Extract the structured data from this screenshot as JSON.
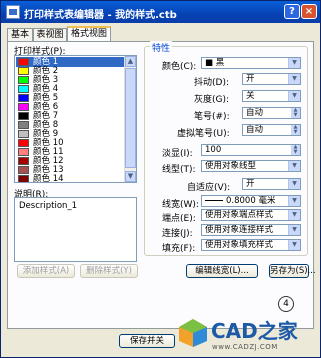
{
  "window": {
    "title": "打印样式表编辑器 - 我的样式.ctb"
  },
  "tabs": [
    {
      "label": "基本"
    },
    {
      "label": "表视图"
    },
    {
      "label": "格式视图"
    }
  ],
  "left": {
    "styles_label": "打印样式(P):",
    "styles": [
      {
        "name": "颜色 1",
        "color": "#ff0000",
        "selected": true
      },
      {
        "name": "颜色 2",
        "color": "#ffff00"
      },
      {
        "name": "颜色 3",
        "color": "#00ff00"
      },
      {
        "name": "颜色 4",
        "color": "#00ffff"
      },
      {
        "name": "颜色 5",
        "color": "#0000ff"
      },
      {
        "name": "颜色 6",
        "color": "#ff00ff"
      },
      {
        "name": "颜色 7",
        "color": "#000000"
      },
      {
        "name": "颜色 8",
        "color": "#808080"
      },
      {
        "name": "颜色 9",
        "color": "#c0c0c0"
      },
      {
        "name": "颜色 10",
        "color": "#ff0000"
      },
      {
        "name": "颜色 11",
        "color": "#ff7f7f"
      },
      {
        "name": "颜色 12",
        "color": "#a50000"
      },
      {
        "name": "颜色 13",
        "color": "#a55252"
      },
      {
        "name": "颜色 14",
        "color": "#7f0000"
      }
    ],
    "description_label": "说明(R):",
    "description_value": "Description_1",
    "add_style_label": "添加样式(A)",
    "delete_style_label": "删除样式(Y)"
  },
  "props": {
    "group_title": "特性",
    "color_label": "颜色(C):",
    "color_value": "■ 黑",
    "dither_label": "抖动(D):",
    "dither_value": "开",
    "grayscale_label": "灰度(G):",
    "grayscale_value": "关",
    "pen_label": "笔号(#):",
    "pen_value": "自动",
    "vpen_label": "虚拟笔号(U):",
    "vpen_value": "自动",
    "screening_label": "淡显(I):",
    "screening_value": "100",
    "linetype_label": "线型(T):",
    "linetype_value": "使用对象线型",
    "adaptive_label": "自适应(V):",
    "adaptive_value": "开",
    "lineweight_label": "线宽(W):",
    "lineweight_value": "0.8000 毫米",
    "endstyle_label": "端点(E):",
    "endstyle_value": "使用对象端点样式",
    "joinstyle_label": "连接(J):",
    "joinstyle_value": "使用对象连接样式",
    "fillstyle_label": "填充(F):",
    "fillstyle_value": "使用对象填充样式",
    "edit_lineweights_label": "编辑线宽(L)...",
    "save_as_label": "另存为(S)..."
  },
  "footer": {
    "save_close_label": "保存并关",
    "callout_number": "4"
  },
  "watermark": {
    "brand": "CAD之家",
    "url": "www.CADZJ.COM"
  }
}
